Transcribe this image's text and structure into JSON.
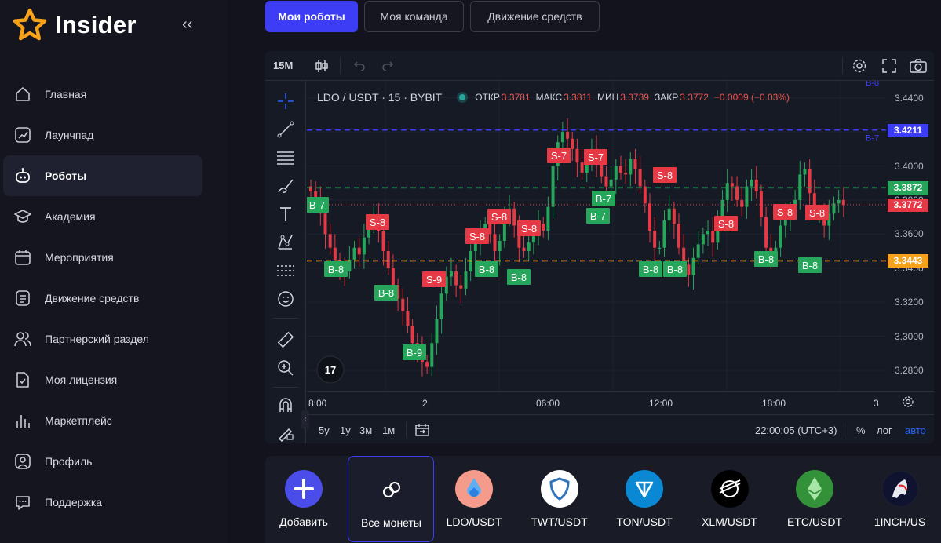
{
  "brand": {
    "name": "Insider",
    "collapse_icon": "‹‹"
  },
  "sidebar": {
    "items": [
      {
        "label": "Главная",
        "icon": "home-icon",
        "active": false
      },
      {
        "label": "Лаунчпад",
        "icon": "launchpad-icon",
        "active": false
      },
      {
        "label": "Роботы",
        "icon": "robot-icon",
        "active": true
      },
      {
        "label": "Академия",
        "icon": "academy-icon",
        "active": false
      },
      {
        "label": "Мероприятия",
        "icon": "calendar-icon",
        "active": false
      },
      {
        "label": "Движение средств",
        "icon": "wallet-icon",
        "active": false
      },
      {
        "label": "Партнерский раздел",
        "icon": "partners-icon",
        "active": false
      },
      {
        "label": "Моя лицензия",
        "icon": "license-icon",
        "active": false
      },
      {
        "label": "Маркетплейс",
        "icon": "marketplace-icon",
        "active": false
      },
      {
        "label": "Профиль",
        "icon": "profile-icon",
        "active": false
      },
      {
        "label": "Поддержка",
        "icon": "support-icon",
        "active": false
      }
    ]
  },
  "tabs": [
    {
      "label": "Мои роботы",
      "active": true
    },
    {
      "label": "Моя команда",
      "active": false
    },
    {
      "label": "Движение средств",
      "active": false
    }
  ],
  "chart": {
    "interval": "15М",
    "symbol": "LDO / USDT · 15 · BYBIT",
    "ohlc": {
      "open_label": "ОТКР",
      "open": "3.3781",
      "high_label": "МАКС",
      "high": "3.3811",
      "low_label": "МИН",
      "low": "3.3739",
      "close_label": "ЗАКР",
      "close": "3.3772",
      "change": "−0.0009 (−0.03%)"
    },
    "price_ticks": [
      "3.4400",
      "3.4000",
      "3.3600",
      "3.3200",
      "3.3000",
      "3.2800"
    ],
    "price_ticks_faded": [
      "3.3800",
      "3.3400"
    ],
    "time_ticks": [
      "8:00",
      "2",
      "06:00",
      "12:00",
      "18:00",
      "3"
    ],
    "levels": [
      {
        "price": "3.4211",
        "color": "#3d3df5",
        "label": "B-7"
      },
      {
        "price": "3.3872",
        "color": "#26a65b",
        "label": ""
      },
      {
        "price": "3.3772",
        "color": "#e53945",
        "label": ""
      },
      {
        "price": "3.3443",
        "color": "#f7a21b",
        "label": ""
      }
    ],
    "top_tag": "B-8",
    "ranges": [
      "5у",
      "1у",
      "3м",
      "1м"
    ],
    "time_display": "22:00:05 (UTC+3)",
    "percent": "%",
    "log": "лог",
    "auto": "авто",
    "signals": [
      {
        "text": "B-7",
        "type": "buy"
      },
      {
        "text": "S-8",
        "type": "sell"
      },
      {
        "text": "B-8",
        "type": "buy"
      },
      {
        "text": "B-8",
        "type": "buy"
      },
      {
        "text": "B-9",
        "type": "buy"
      },
      {
        "text": "S-9",
        "type": "sell"
      },
      {
        "text": "S-8",
        "type": "sell"
      },
      {
        "text": "B-8",
        "type": "buy"
      },
      {
        "text": "S-8",
        "type": "sell"
      },
      {
        "text": "S-8",
        "type": "sell"
      },
      {
        "text": "B-8",
        "type": "buy"
      },
      {
        "text": "S-7",
        "type": "sell"
      },
      {
        "text": "S-7",
        "type": "sell"
      },
      {
        "text": "B-7",
        "type": "buy"
      },
      {
        "text": "B-7",
        "type": "buy"
      },
      {
        "text": "S-8",
        "type": "sell"
      },
      {
        "text": "B-8",
        "type": "buy"
      },
      {
        "text": "B-8",
        "type": "buy"
      },
      {
        "text": "S-8",
        "type": "sell"
      },
      {
        "text": "B-8",
        "type": "buy"
      },
      {
        "text": "S-8",
        "type": "sell"
      },
      {
        "text": "S-8",
        "type": "sell"
      },
      {
        "text": "B-8",
        "type": "buy"
      }
    ]
  },
  "coins": [
    {
      "label": "Добавить",
      "icon": "plus-icon",
      "color": "#4b4de8"
    },
    {
      "label": "Все монеты",
      "icon": "coins-icon",
      "color": "#1b1d2c",
      "selected": true
    },
    {
      "label": "LDO/USDT",
      "icon": "ldo-icon",
      "color": "#f59b8c"
    },
    {
      "label": "TWT/USDT",
      "icon": "twt-icon",
      "color": "#ffffff"
    },
    {
      "label": "TON/USDT",
      "icon": "ton-icon",
      "color": "#0a88d4"
    },
    {
      "label": "XLM/USDT",
      "icon": "xlm-icon",
      "color": "#000000"
    },
    {
      "label": "ETC/USDT",
      "icon": "etc-icon",
      "color": "#339239"
    },
    {
      "label": "1INCH/US",
      "icon": "oneinch-icon",
      "color": "#1b1d2c"
    }
  ]
}
